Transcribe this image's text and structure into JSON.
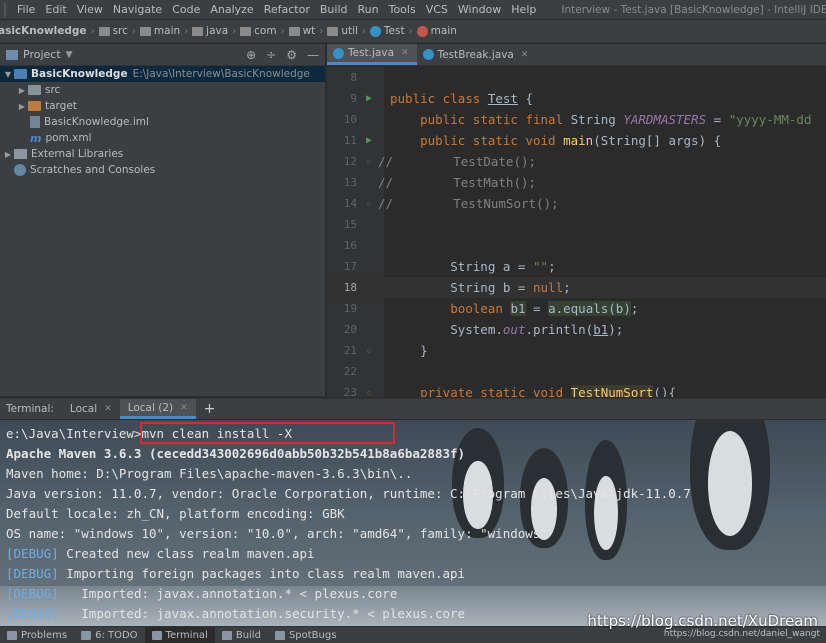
{
  "menubar": {
    "items": [
      "File",
      "Edit",
      "View",
      "Navigate",
      "Code",
      "Analyze",
      "Refactor",
      "Build",
      "Run",
      "Tools",
      "VCS",
      "Window",
      "Help"
    ],
    "title": "Interview - Test.java [BasicKnowledge] - IntelliJ IDEA"
  },
  "breadcrumb": [
    "asicKnowledge",
    "src",
    "main",
    "java",
    "com",
    "wt",
    "util",
    "Test",
    "main"
  ],
  "project": {
    "title": "Project",
    "root": {
      "name": "BasicKnowledge",
      "path": "E:\\Java\\Interview\\BasicKnowledge"
    },
    "items": [
      "src",
      "target",
      "BasicKnowledge.iml",
      "pom.xml"
    ],
    "external": "External Libraries",
    "scratches": "Scratches and Consoles"
  },
  "editor": {
    "tabs": [
      "Test.java",
      "TestBreak.java"
    ],
    "line_numbers": [
      "8",
      "9",
      "10",
      "11",
      "12",
      "13",
      "14",
      "15",
      "16",
      "17",
      "18",
      "19",
      "20",
      "21",
      "22",
      "23"
    ],
    "current_line": "18"
  },
  "terminal": {
    "label": "Terminal:",
    "tabs": [
      "Local",
      "Local (2)"
    ],
    "add": "+",
    "prompt": "e:\\Java\\Interview>",
    "command": "mvn clean install -X",
    "lines": [
      "Apache Maven 3.6.3 (cecedd343002696d0abb50b32b541b8a6ba2883f)",
      "Maven home: D:\\Program Files\\apache-maven-3.6.3\\bin\\..",
      "Java version: 11.0.7, vendor: Oracle Corporation, runtime: C:\\Program Files\\Java\\jdk-11.0.7",
      "Default locale: zh_CN, platform encoding: GBK",
      "OS name: \"windows 10\", version: \"10.0\", arch: \"amd64\", family: \"windows\""
    ],
    "debug_tag": "[DEBUG]",
    "debug_lines": [
      " Created new class realm maven.api",
      " Importing foreign packages into class realm maven.api",
      "   Imported: javax.annotation.* < plexus.core",
      "   Imported: javax.annotation.security.* < plexus.core"
    ]
  },
  "statusbar": {
    "items": [
      "Problems",
      "6: TODO",
      "Terminal",
      "Build",
      "SpotBugs"
    ]
  },
  "watermark": "https://blog.csdn.net/XuDream",
  "watermark_small": "https://blog.csdn.net/daniel_wangt",
  "colors": {
    "accent": "#4a88c7",
    "highlight_box": "#e0262a",
    "keyword": "#cc7832",
    "string": "#6a8759"
  }
}
